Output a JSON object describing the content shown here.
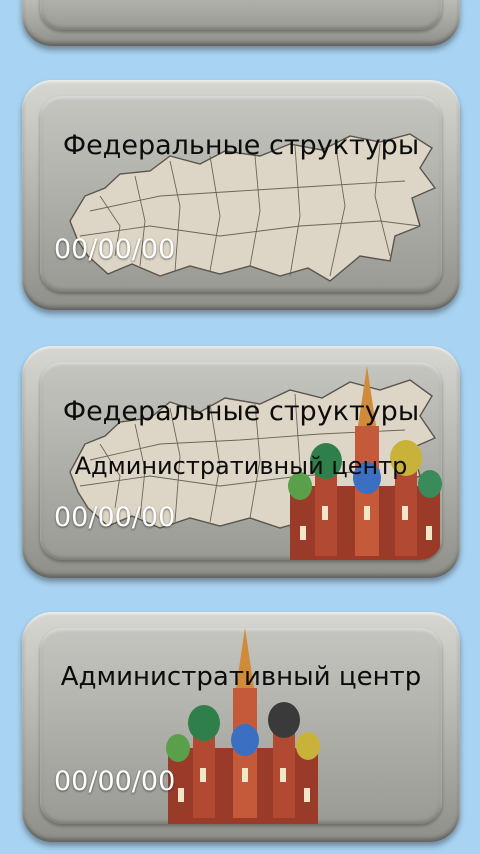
{
  "cards": [
    {
      "title": "Федеральные структуры",
      "date": "00/00/00"
    },
    {
      "title": "Федеральные структуры",
      "subtitle": "Административный центр",
      "date": "00/00/00"
    },
    {
      "title": "Административный центр",
      "date": "00/00/00"
    }
  ],
  "colors": {
    "background": "#a9d3f2",
    "card": "#b8b8b2",
    "map_fill": "#ddd6c6",
    "date_text": "#ffffff",
    "title_text": "#0c0c0c"
  },
  "icons": [
    "russia-map-icon",
    "kremlin-icon"
  ]
}
